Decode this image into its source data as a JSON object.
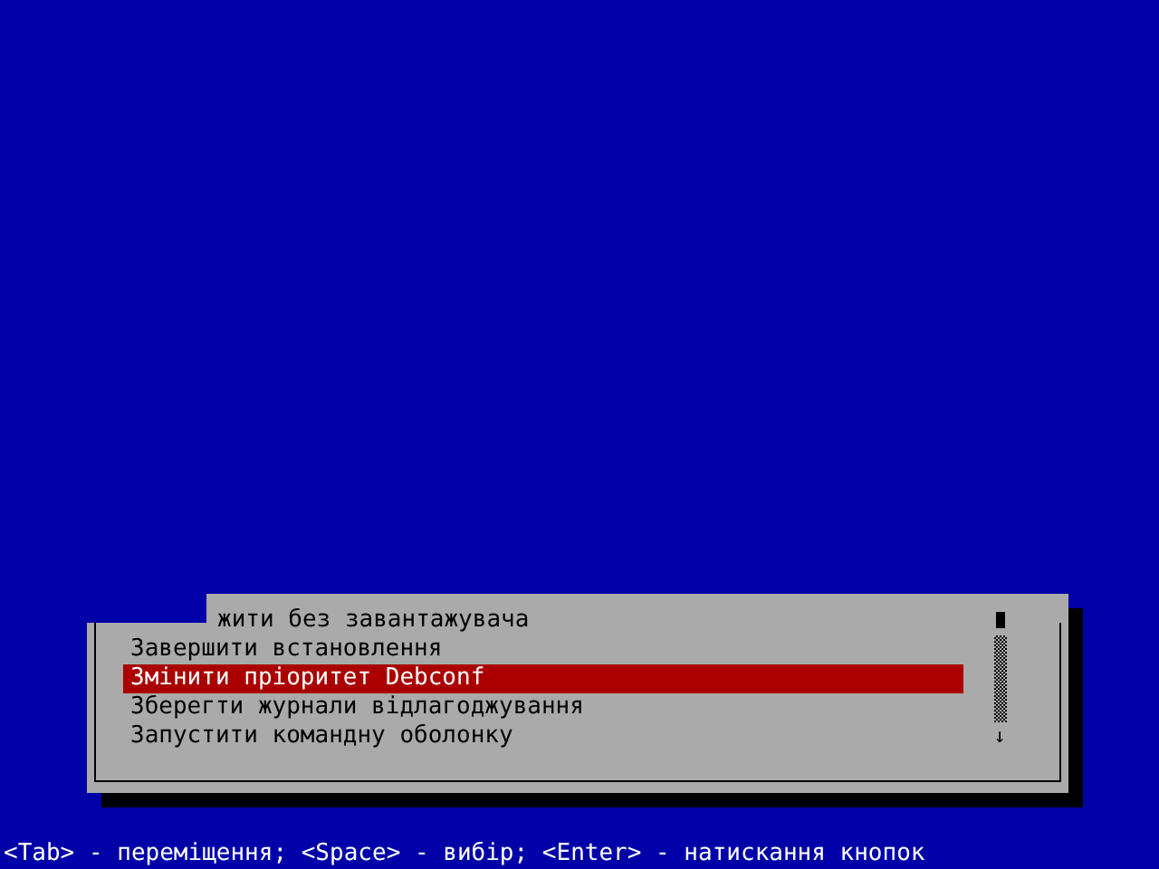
{
  "menu": {
    "items": [
      {
        "label": "жити без завантажувача",
        "selected": false,
        "kind": "clipped"
      },
      {
        "label": "Завершити встановлення",
        "selected": false
      },
      {
        "label": "Змінити пріоритет Debconf",
        "selected": true
      },
      {
        "label": "Зберегти журнали відлагоджування",
        "selected": false
      },
      {
        "label": "Запустити командну оболонку",
        "selected": false
      }
    ]
  },
  "scrollbar": {
    "arrow": "↓"
  },
  "status_bar": "<Tab> - переміщення; <Space> - вибір; <Enter> - натискання кнопок"
}
